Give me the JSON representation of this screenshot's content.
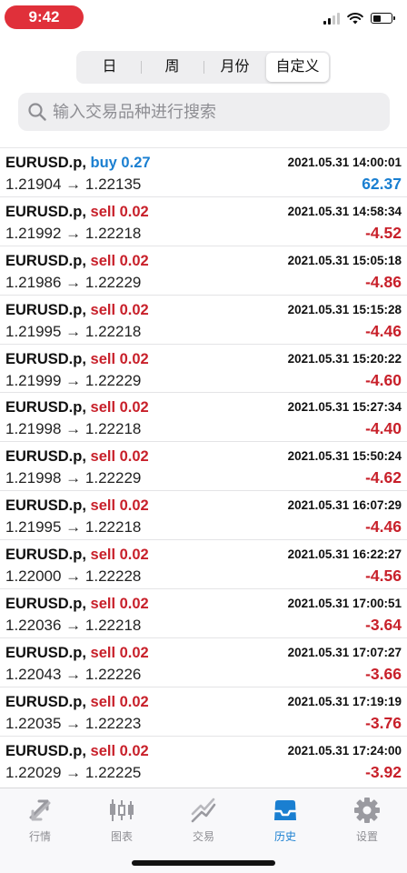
{
  "status_bar": {
    "time": "9:42"
  },
  "period_tabs": [
    {
      "label": "日",
      "active": false
    },
    {
      "label": "周",
      "active": false
    },
    {
      "label": "月份",
      "active": false
    },
    {
      "label": "自定义",
      "active": true
    }
  ],
  "search": {
    "placeholder": "输入交易品种进行搜索",
    "value": ""
  },
  "colors": {
    "buy": "#1a7fd1",
    "sell": "#c8202a",
    "accent": "#1a7fd1",
    "status_pill": "#e0303a"
  },
  "trades": [
    {
      "symbol": "EURUSD.p,",
      "side": "buy 0.27",
      "side_type": "buy",
      "prices": "1.21904 → 1.22135",
      "date": "2021.05.31 14:00:01",
      "profit": "62.37"
    },
    {
      "symbol": "EURUSD.p,",
      "side": "sell 0.02",
      "side_type": "sell",
      "prices": "1.21992 → 1.22218",
      "date": "2021.05.31 14:58:34",
      "profit": "-4.52"
    },
    {
      "symbol": "EURUSD.p,",
      "side": "sell 0.02",
      "side_type": "sell",
      "prices": "1.21986 → 1.22229",
      "date": "2021.05.31 15:05:18",
      "profit": "-4.86"
    },
    {
      "symbol": "EURUSD.p,",
      "side": "sell 0.02",
      "side_type": "sell",
      "prices": "1.21995 → 1.22218",
      "date": "2021.05.31 15:15:28",
      "profit": "-4.46"
    },
    {
      "symbol": "EURUSD.p,",
      "side": "sell 0.02",
      "side_type": "sell",
      "prices": "1.21999 → 1.22229",
      "date": "2021.05.31 15:20:22",
      "profit": "-4.60"
    },
    {
      "symbol": "EURUSD.p,",
      "side": "sell 0.02",
      "side_type": "sell",
      "prices": "1.21998 → 1.22218",
      "date": "2021.05.31 15:27:34",
      "profit": "-4.40"
    },
    {
      "symbol": "EURUSD.p,",
      "side": "sell 0.02",
      "side_type": "sell",
      "prices": "1.21998 → 1.22229",
      "date": "2021.05.31 15:50:24",
      "profit": "-4.62"
    },
    {
      "symbol": "EURUSD.p,",
      "side": "sell 0.02",
      "side_type": "sell",
      "prices": "1.21995 → 1.22218",
      "date": "2021.05.31 16:07:29",
      "profit": "-4.46"
    },
    {
      "symbol": "EURUSD.p,",
      "side": "sell 0.02",
      "side_type": "sell",
      "prices": "1.22000 → 1.22228",
      "date": "2021.05.31 16:22:27",
      "profit": "-4.56"
    },
    {
      "symbol": "EURUSD.p,",
      "side": "sell 0.02",
      "side_type": "sell",
      "prices": "1.22036 → 1.22218",
      "date": "2021.05.31 17:00:51",
      "profit": "-3.64"
    },
    {
      "symbol": "EURUSD.p,",
      "side": "sell 0.02",
      "side_type": "sell",
      "prices": "1.22043 → 1.22226",
      "date": "2021.05.31 17:07:27",
      "profit": "-3.66"
    },
    {
      "symbol": "EURUSD.p,",
      "side": "sell 0.02",
      "side_type": "sell",
      "prices": "1.22035 → 1.22223",
      "date": "2021.05.31 17:19:19",
      "profit": "-3.76"
    },
    {
      "symbol": "EURUSD.p,",
      "side": "sell 0.02",
      "side_type": "sell",
      "prices": "1.22029 → 1.22225",
      "date": "2021.05.31 17:24:00",
      "profit": "-3.92"
    }
  ],
  "tab_bar": [
    {
      "label": "行情",
      "icon": "quotes-icon",
      "active": false
    },
    {
      "label": "图表",
      "icon": "chart-icon",
      "active": false
    },
    {
      "label": "交易",
      "icon": "trade-icon",
      "active": false
    },
    {
      "label": "历史",
      "icon": "history-icon",
      "active": true
    },
    {
      "label": "设置",
      "icon": "gear-icon",
      "active": false
    }
  ]
}
